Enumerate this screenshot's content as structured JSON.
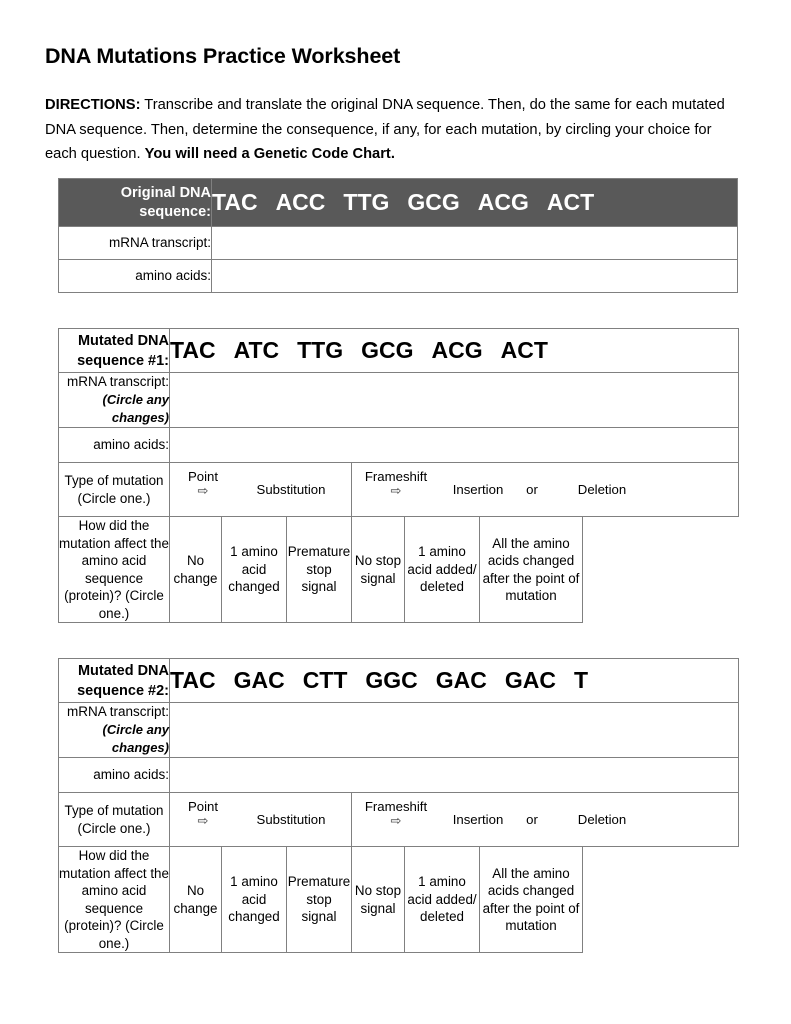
{
  "document": {
    "title": "DNA Mutations Practice Worksheet",
    "directions_label": "DIRECTIONS:",
    "directions_text": " Transcribe and translate the original DNA sequence. Then, do the same for each mutated DNA sequence. Then, determine the consequence, if any, for each mutation, by circling your choice for each question. ",
    "directions_bold_tail": "You will need a Genetic Code Chart."
  },
  "colors": {
    "header_fill": "#595959",
    "header_text": "#ffffff",
    "border": "#808080",
    "page_background": "#ffffff",
    "body_text": "#000000"
  },
  "labels": {
    "mrna_transcript": "mRNA transcript:",
    "circle_any_changes": "(Circle any changes)",
    "amino_acids": "amino acids:",
    "type_of_mutation": "Type of mutation (Circle one.)",
    "how_did_affect": "How did the mutation affect the amino acid sequence (protein)? (Circle one.)"
  },
  "mutation_type": {
    "point_label": "Point",
    "point_arrow": "⇨",
    "substitution": "Substitution",
    "frameshift_label": "Frameshift",
    "frameshift_arrow": "⇨",
    "insertion": "Insertion",
    "or": "or",
    "deletion": "Deletion"
  },
  "consequence_options": [
    "No change",
    "1 amino acid changed",
    "Premature stop signal",
    "No stop signal",
    "1 amino acid added/ deleted",
    "All the amino acids changed after the point of mutation"
  ],
  "tables": [
    {
      "id": "original",
      "header_label": "Original DNA sequence:",
      "header_dark": true,
      "codons": [
        "TAC",
        "ACC",
        "TTG",
        "GCG",
        "ACG",
        "ACT"
      ],
      "has_circle_note": false,
      "has_mutation_rows": false
    },
    {
      "id": "mutated-1",
      "header_label": "Mutated DNA sequence #1:",
      "header_dark": false,
      "codons": [
        "TAC",
        "ATC",
        "TTG",
        "GCG",
        "ACG",
        "ACT"
      ],
      "has_circle_note": true,
      "has_mutation_rows": true
    },
    {
      "id": "mutated-2",
      "header_label": "Mutated DNA sequence #2:",
      "header_dark": false,
      "codons": [
        "TAC",
        "GAC",
        "CTT",
        "GGC",
        "GAC",
        "GAC",
        "T"
      ],
      "has_circle_note": true,
      "has_mutation_rows": true
    }
  ]
}
